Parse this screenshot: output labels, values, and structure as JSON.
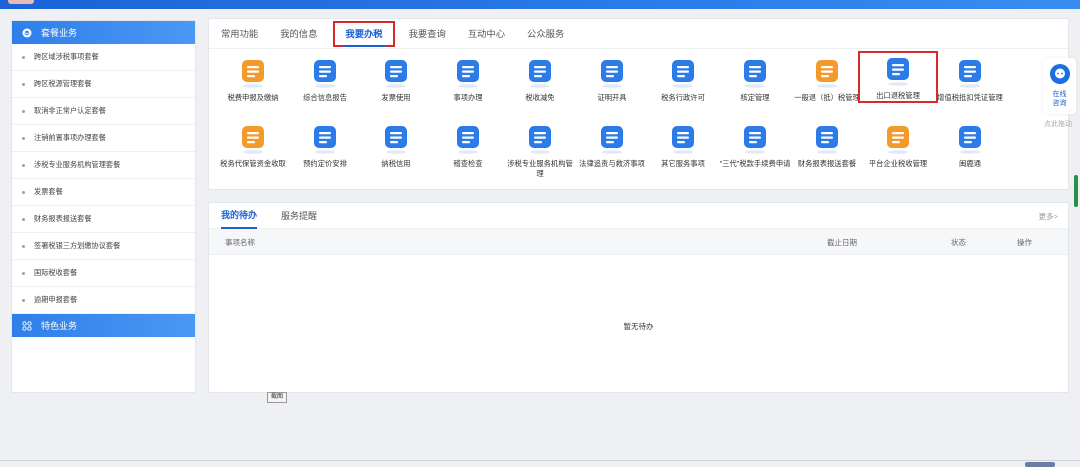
{
  "sidebar": {
    "section1_title": "套餐业务",
    "items": [
      {
        "label": "跨区域涉税事项套餐"
      },
      {
        "label": "跨区税源管理套餐"
      },
      {
        "label": "取消非正常户认定套餐"
      },
      {
        "label": "注销前置事项办理套餐"
      },
      {
        "label": "涉税专业服务机构管理套餐"
      },
      {
        "label": "发票套餐"
      },
      {
        "label": "财务报表报送套餐"
      },
      {
        "label": "签署税银三方划缴协议套餐"
      },
      {
        "label": "国际税收套餐"
      },
      {
        "label": "逾期申报套餐"
      }
    ],
    "section2_title": "特色业务"
  },
  "top_tabs": [
    {
      "label": "常用功能"
    },
    {
      "label": "我的信息"
    },
    {
      "label": "我要办税"
    },
    {
      "label": "我要查询"
    },
    {
      "label": "互动中心"
    },
    {
      "label": "公众服务"
    }
  ],
  "functions": [
    {
      "label": "税费申报及缴纳",
      "icon": "tax-payment-icon",
      "color": "#f39a2b"
    },
    {
      "label": "综合信息报告",
      "icon": "document-report-icon",
      "color": "#2b7be9"
    },
    {
      "label": "发票使用",
      "icon": "invoice-icon",
      "color": "#2b7be9"
    },
    {
      "label": "事项办理",
      "icon": "edit-matter-icon",
      "color": "#2b7be9"
    },
    {
      "label": "税收减免",
      "icon": "tax-relief-icon",
      "color": "#2b7be9"
    },
    {
      "label": "证明开具",
      "icon": "certificate-icon",
      "color": "#2b7be9"
    },
    {
      "label": "税务行政许可",
      "icon": "license-icon",
      "color": "#2b7be9"
    },
    {
      "label": "核定管理",
      "icon": "assessment-icon",
      "color": "#2b7be9"
    },
    {
      "label": "一般退（抵）税管理",
      "icon": "refund-icon",
      "color": "#f39a2b"
    },
    {
      "label": "出口退税管理",
      "icon": "export-refund-icon",
      "color": "#2b7be9"
    },
    {
      "label": "增值税抵扣凭证管理",
      "icon": "vat-deduction-icon",
      "color": "#2b7be9"
    },
    {
      "label": "税务代保管资金收取",
      "icon": "money-bag-icon",
      "color": "#f39a2b"
    },
    {
      "label": "预约定价安排",
      "icon": "pricing-clock-icon",
      "color": "#2b7be9"
    },
    {
      "label": "纳税信用",
      "icon": "credit-icon",
      "color": "#2b7be9"
    },
    {
      "label": "稽查检查",
      "icon": "inspection-icon",
      "color": "#2b7be9"
    },
    {
      "label": "涉税专业服务机构管理",
      "icon": "agency-icon",
      "color": "#2b7be9"
    },
    {
      "label": "法律追责与救济事项",
      "icon": "gavel-icon",
      "color": "#2b7be9"
    },
    {
      "label": "其它服务事项",
      "icon": "clipboard-icon",
      "color": "#2b7be9"
    },
    {
      "label": "\"三代\"税款手续费申请",
      "icon": "fee-bag-icon",
      "color": "#2b7be9"
    },
    {
      "label": "财务报表报送套餐",
      "icon": "report-stack-icon",
      "color": "#2b7be9"
    },
    {
      "label": "平台企业税收管理",
      "icon": "platform-icon",
      "color": "#f39a2b"
    },
    {
      "label": "闽鹿通",
      "icon": "lightbulb-icon",
      "color": "#2b7be9"
    }
  ],
  "todo": {
    "tabs": [
      {
        "label": "我的待办"
      },
      {
        "label": "服务提醒"
      }
    ],
    "more": "更多>",
    "columns": {
      "name": "事项名称",
      "deadline": "截止日期",
      "status": "状态",
      "action": "操作"
    },
    "empty": "暂无待办"
  },
  "screenshot_btn": "截图",
  "float": {
    "label1": "在线",
    "label2": "咨询",
    "drag_hint": "点此拖动"
  }
}
